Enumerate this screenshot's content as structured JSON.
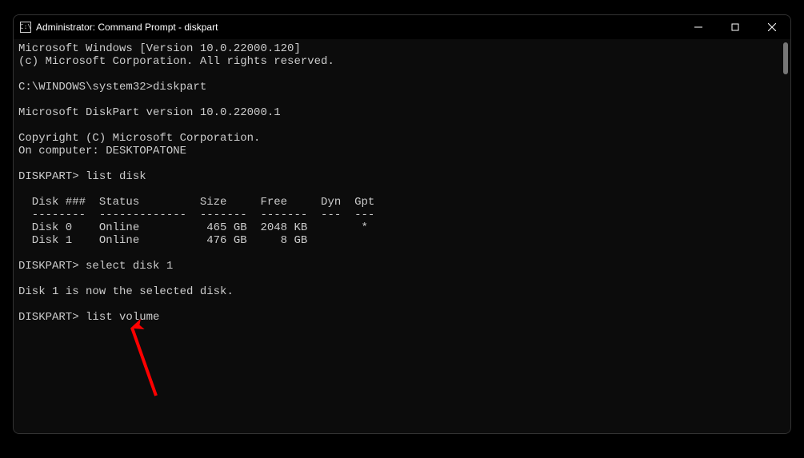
{
  "window": {
    "title": "Administrator: Command Prompt - diskpart",
    "icon_glyph": "C:\\"
  },
  "terminal": {
    "lines": [
      "Microsoft Windows [Version 10.0.22000.120]",
      "(c) Microsoft Corporation. All rights reserved.",
      "",
      "C:\\WINDOWS\\system32>diskpart",
      "",
      "Microsoft DiskPart version 10.0.22000.1",
      "",
      "Copyright (C) Microsoft Corporation.",
      "On computer: DESKTOPATONE",
      "",
      "DISKPART> list disk",
      "",
      "  Disk ###  Status         Size     Free     Dyn  Gpt",
      "  --------  -------------  -------  -------  ---  ---",
      "  Disk 0    Online          465 GB  2048 KB        *",
      "  Disk 1    Online          476 GB     8 GB",
      "",
      "DISKPART> select disk 1",
      "",
      "Disk 1 is now the selected disk.",
      "",
      "DISKPART> list volume",
      ""
    ]
  },
  "annotation": {
    "color": "#ff0000",
    "target_text": "list volume"
  }
}
